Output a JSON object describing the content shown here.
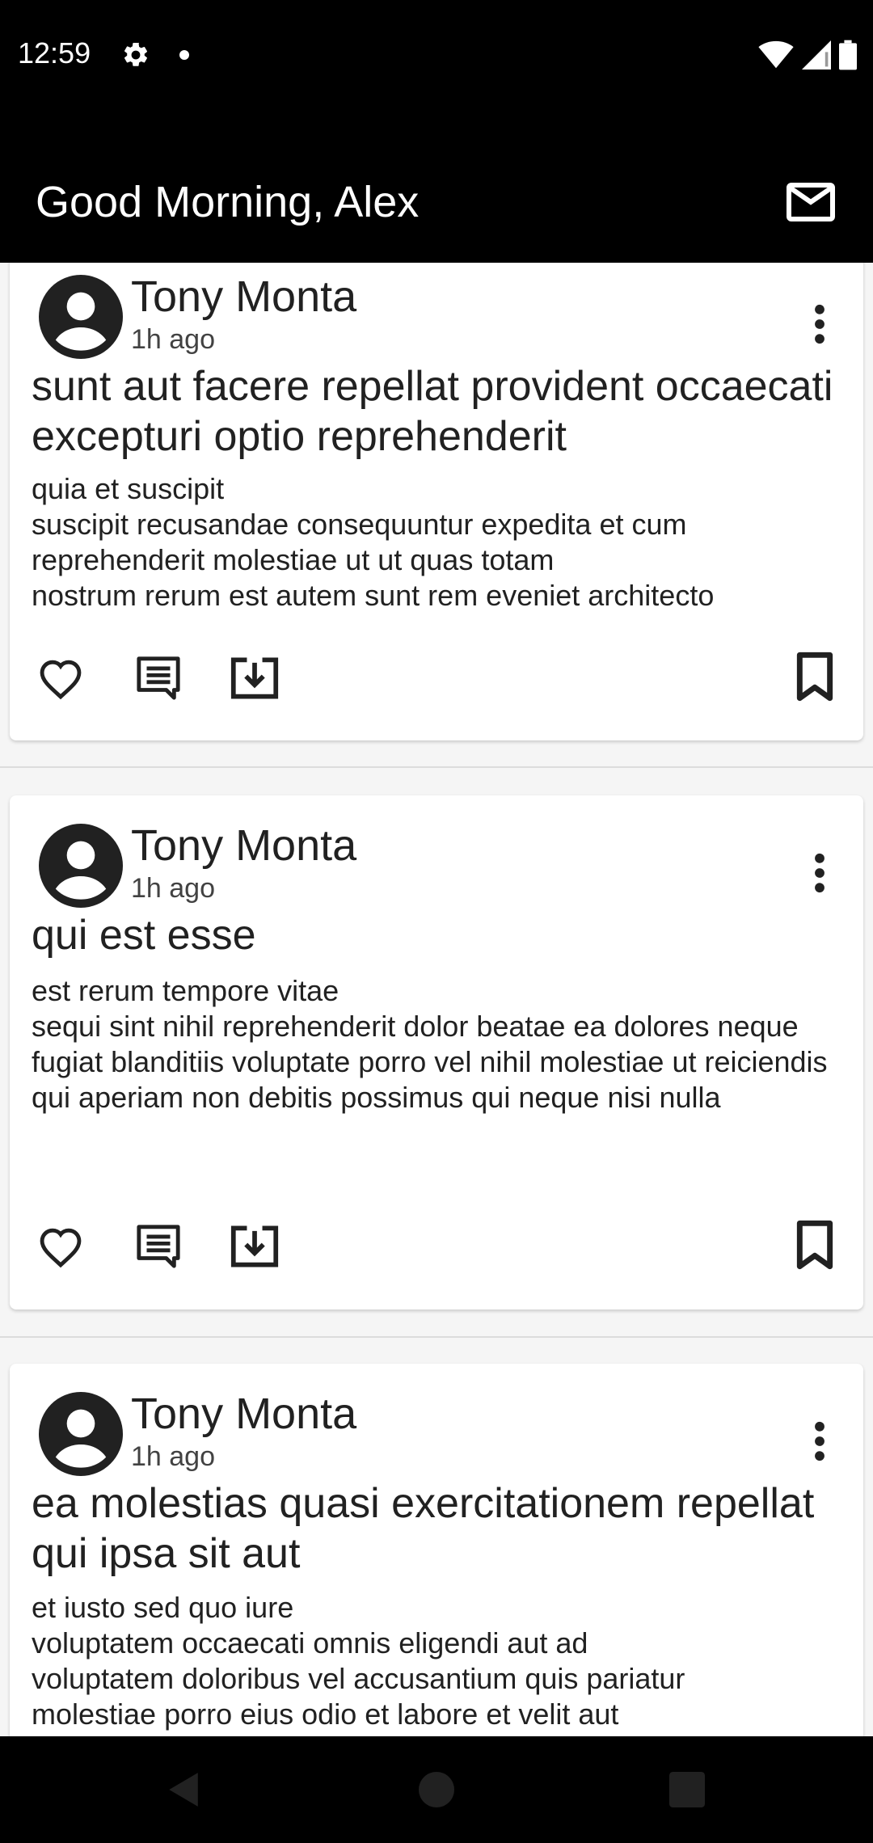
{
  "status_bar": {
    "time": "12:59",
    "icons": [
      "gear-icon",
      "dot-icon",
      "wifi-icon",
      "signal-icon",
      "battery-icon"
    ]
  },
  "app_bar": {
    "title": "Good Morning, Alex",
    "action_icon": "mail-icon"
  },
  "posts": [
    {
      "author": "Tony Monta",
      "time": "1h ago",
      "title": "sunt aut facere repellat provident occaecati excepturi optio reprehenderit",
      "body": "quia et suscipit\nsuscipit recusandae consequuntur expedita et cum reprehenderit molestiae ut ut quas totam\nnostrum rerum est autem sunt rem eveniet architecto"
    },
    {
      "author": "Tony Monta",
      "time": "1h ago",
      "title": "qui est esse",
      "body": "est rerum tempore vitae\nsequi sint nihil reprehenderit dolor beatae ea dolores neque\nfugiat blanditiis voluptate porro vel nihil molestiae ut reiciendis\nqui aperiam non debitis possimus qui neque nisi nulla"
    },
    {
      "author": "Tony Monta",
      "time": "1h ago",
      "title": "ea molestias quasi exercitationem repellat qui ipsa sit aut",
      "body": "et iusto sed quo iure\nvoluptatem occaecati omnis eligendi aut ad\nvoluptatem doloribus vel accusantium quis pariatur\nmolestiae porro eius odio et labore et velit aut"
    }
  ],
  "post_actions": [
    "heart-icon",
    "comment-icon",
    "download-icon",
    "bookmark-icon"
  ],
  "nav_bar": [
    "back-icon",
    "home-icon",
    "recents-icon"
  ]
}
